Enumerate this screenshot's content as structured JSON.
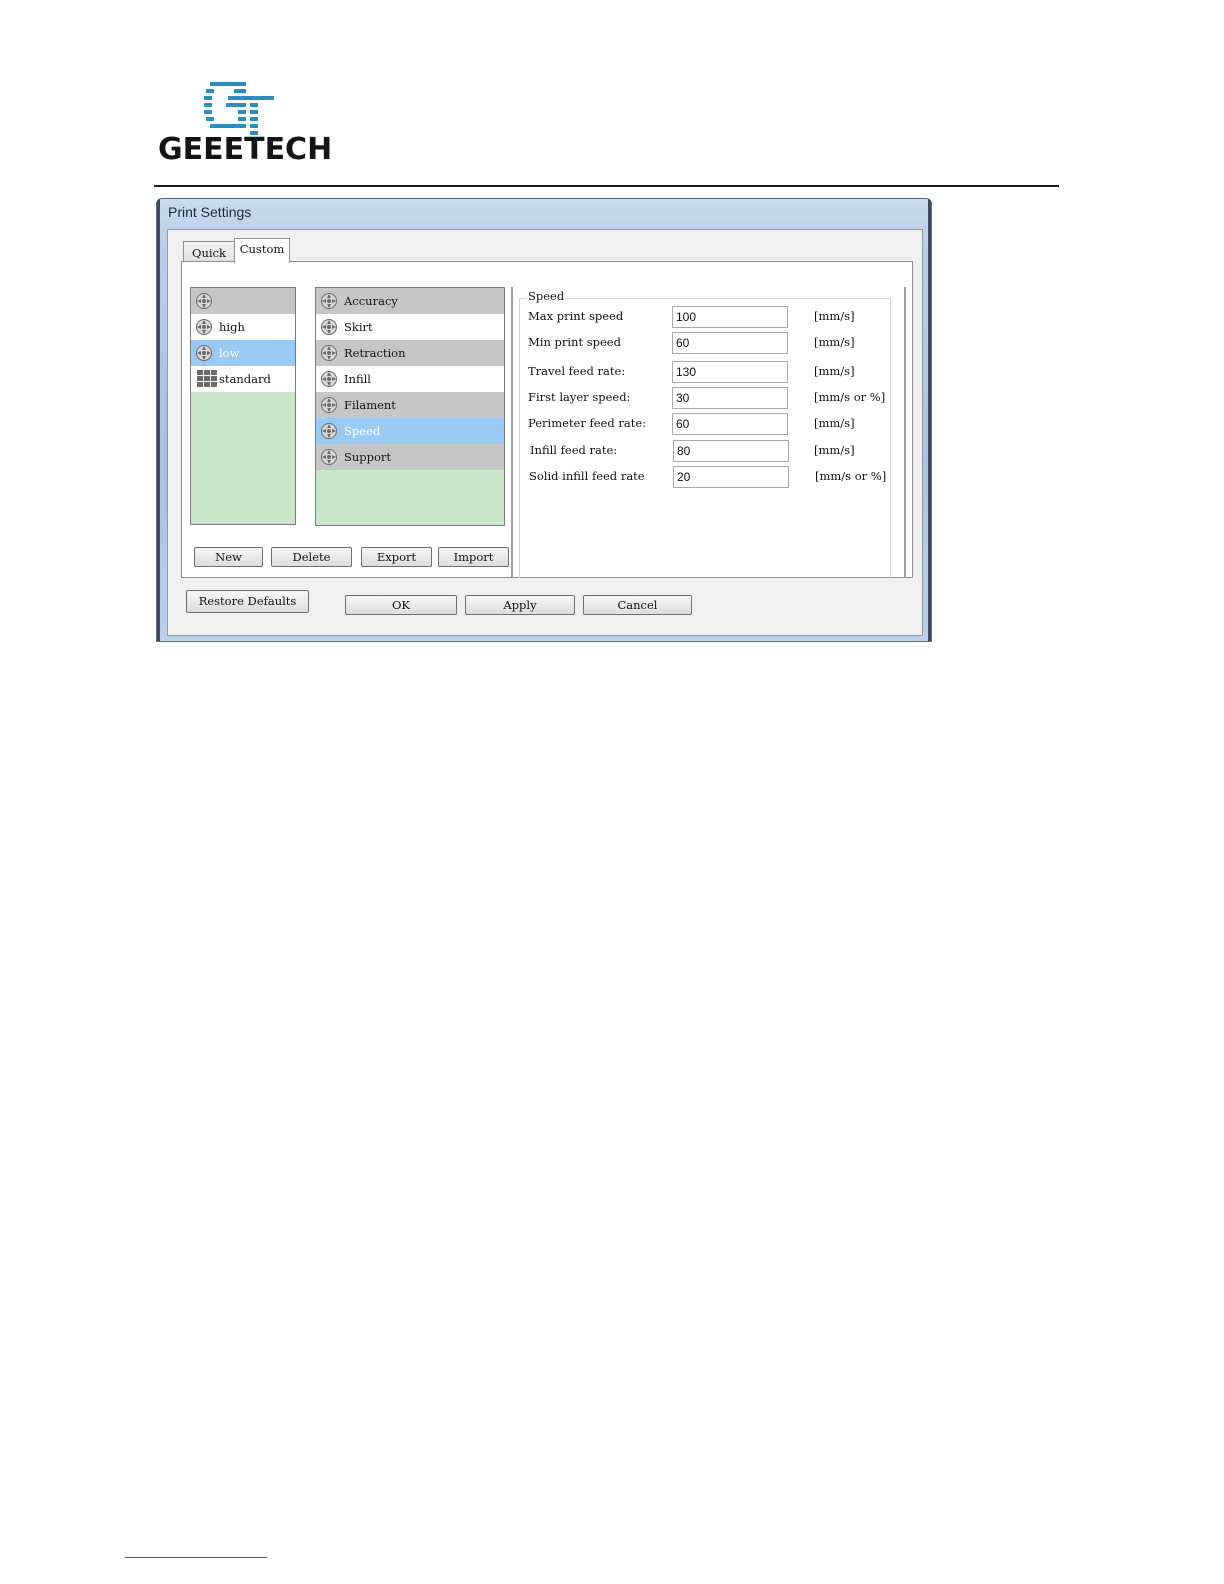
{
  "document": {
    "logo_text": "GEEETECH"
  },
  "window": {
    "title": "Print Settings"
  },
  "tabs": [
    {
      "label": "Quick",
      "active": false
    },
    {
      "label": "Custom",
      "active": true
    }
  ],
  "profiles": {
    "items": [
      {
        "label": "",
        "icon": "gear-icon",
        "style": "shade"
      },
      {
        "label": "high",
        "icon": "gear-icon",
        "style": "white"
      },
      {
        "label": "low",
        "icon": "gear-icon",
        "style": "selected"
      },
      {
        "label": "standard",
        "icon": "grid-icon",
        "style": "white"
      }
    ]
  },
  "categories": {
    "items": [
      {
        "label": "Accuracy",
        "icon": "gear-icon",
        "style": "shade"
      },
      {
        "label": "Skirt",
        "icon": "gear-icon",
        "style": "white"
      },
      {
        "label": "Retraction",
        "icon": "gear-icon",
        "style": "shade"
      },
      {
        "label": "Infill",
        "icon": "gear-icon",
        "style": "white"
      },
      {
        "label": "Filament",
        "icon": "gear-icon",
        "style": "shade"
      },
      {
        "label": "Speed",
        "icon": "gear-icon",
        "style": "selected"
      },
      {
        "label": "Support",
        "icon": "gear-icon",
        "style": "shade"
      }
    ]
  },
  "profile_buttons": {
    "new": "New",
    "delete": "Delete",
    "export": "Export",
    "import": "Import"
  },
  "speed": {
    "title": "Speed",
    "fields": [
      {
        "label": "Max print speed",
        "value": "100",
        "unit": "[mm/s]"
      },
      {
        "label": "Min print speed",
        "value": "60",
        "unit": "[mm/s]"
      },
      {
        "label": "Travel feed rate:",
        "value": "130",
        "unit": "[mm/s]"
      },
      {
        "label": "First layer speed:",
        "value": "30",
        "unit": "[mm/s or %]"
      },
      {
        "label": "Perimeter feed rate:",
        "value": "60",
        "unit": "[mm/s]"
      },
      {
        "label": "Infill feed rate:",
        "value": "80",
        "unit": "[mm/s]"
      },
      {
        "label": "Solid infill feed rate",
        "value": "20",
        "unit": "[mm/s or %]"
      }
    ]
  },
  "footer_buttons": {
    "restore": "Restore Defaults",
    "ok": "OK",
    "apply": "Apply",
    "cancel": "Cancel"
  }
}
